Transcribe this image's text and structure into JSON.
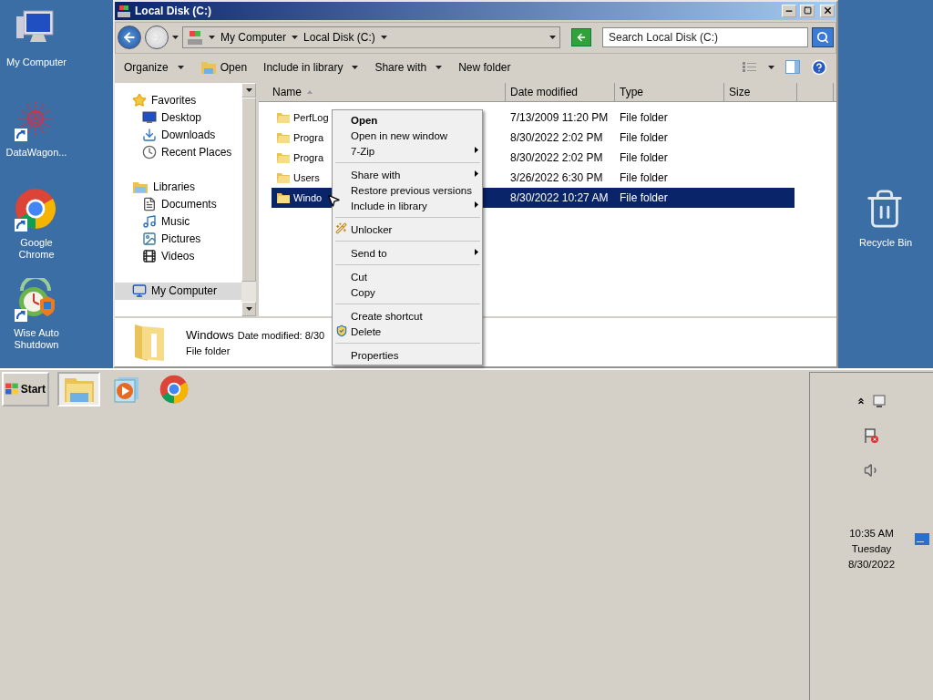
{
  "desktop_icons": [
    {
      "label": "My Computer",
      "shortcut": false
    },
    {
      "label": "DataWagon...",
      "shortcut": true
    },
    {
      "label": "Google Chrome",
      "shortcut": true
    },
    {
      "label": "Wise Auto Shutdown",
      "shortcut": true
    }
  ],
  "recycle_bin": {
    "label": "Recycle Bin"
  },
  "window": {
    "title": "Local Disk (C:)"
  },
  "address_bar": {
    "crumbs": [
      "My Computer",
      "Local Disk (C:)"
    ]
  },
  "search": {
    "placeholder": "Search Local Disk (C:)"
  },
  "command_bar": [
    {
      "label": "Organize",
      "kind": "dropdown"
    },
    {
      "label": "Open",
      "kind": "icon"
    },
    {
      "label": "Include in library",
      "kind": "dropdown"
    },
    {
      "label": "Share with",
      "kind": "dropdown"
    },
    {
      "label": "New folder",
      "kind": "plain"
    }
  ],
  "navigation": [
    {
      "label": "Favorites",
      "selected": false,
      "children": [
        {
          "label": "Desktop",
          "selected": false
        },
        {
          "label": "Downloads",
          "selected": false
        },
        {
          "label": "Recent Places",
          "selected": false
        }
      ]
    },
    {
      "label": "Libraries",
      "selected": false,
      "children": [
        {
          "label": "Documents",
          "selected": false
        },
        {
          "label": "Music",
          "selected": false
        },
        {
          "label": "Pictures",
          "selected": false
        },
        {
          "label": "Videos",
          "selected": false
        }
      ]
    },
    {
      "label": "My Computer",
      "selected": true
    }
  ],
  "file_list": {
    "columns": [
      {
        "label": "Name",
        "sorted": true
      },
      {
        "label": "Date modified",
        "sorted": false
      },
      {
        "label": "Type",
        "sorted": false
      },
      {
        "label": "Size",
        "sorted": false
      }
    ],
    "rows": [
      {
        "name": "PerfLog",
        "date": "7/13/2009 11:20 PM",
        "type": "File folder",
        "selected": false
      },
      {
        "name": "Progra",
        "date": "8/30/2022 2:02 PM",
        "type": "File folder",
        "selected": false
      },
      {
        "name": "Progra",
        "date": "8/30/2022 2:02 PM",
        "type": "File folder",
        "selected": false
      },
      {
        "name": "Users",
        "date": "3/26/2022 6:30 PM",
        "type": "File folder",
        "selected": false
      },
      {
        "name": "Windo",
        "date": "8/30/2022 10:27 AM",
        "type": "File folder",
        "selected": true
      }
    ]
  },
  "details": {
    "name": "Windows",
    "date": "Date modified: 8/30",
    "type": "File folder"
  },
  "context_menu": [
    {
      "kind": "item",
      "label": "Open",
      "default": true,
      "submenu": false
    },
    {
      "kind": "item",
      "label": "Open in new window",
      "default": false,
      "submenu": false
    },
    {
      "kind": "item",
      "label": "7-Zip",
      "default": false,
      "submenu": true
    },
    {
      "kind": "separator"
    },
    {
      "kind": "item",
      "label": "Share with",
      "default": false,
      "submenu": true
    },
    {
      "kind": "item",
      "label": "Restore previous versions",
      "default": false,
      "submenu": false
    },
    {
      "kind": "item",
      "label": "Include in library",
      "default": false,
      "submenu": true
    },
    {
      "kind": "separator"
    },
    {
      "kind": "icon_item",
      "label": "Unlocker",
      "default": false,
      "submenu": false
    },
    {
      "kind": "separator"
    },
    {
      "kind": "item",
      "label": "Send to",
      "default": false,
      "submenu": true
    },
    {
      "kind": "separator"
    },
    {
      "kind": "item",
      "label": "Cut",
      "default": false,
      "submenu": false
    },
    {
      "kind": "item",
      "label": "Copy",
      "default": false,
      "submenu": false
    },
    {
      "kind": "separator"
    },
    {
      "kind": "item",
      "label": "Create shortcut",
      "default": false,
      "submenu": false
    },
    {
      "kind": "icon_item",
      "label": "Delete",
      "default": false,
      "submenu": false
    },
    {
      "kind": "separator"
    },
    {
      "kind": "item",
      "label": "Properties",
      "default": false,
      "submenu": false
    }
  ],
  "taskbar": {
    "start": "Start",
    "items": [
      {
        "selected": true
      },
      {
        "selected": false
      },
      {
        "selected": false
      }
    ]
  },
  "tray": {
    "time": "10:35 AM",
    "day": "Tuesday",
    "date": "8/30/2022"
  }
}
